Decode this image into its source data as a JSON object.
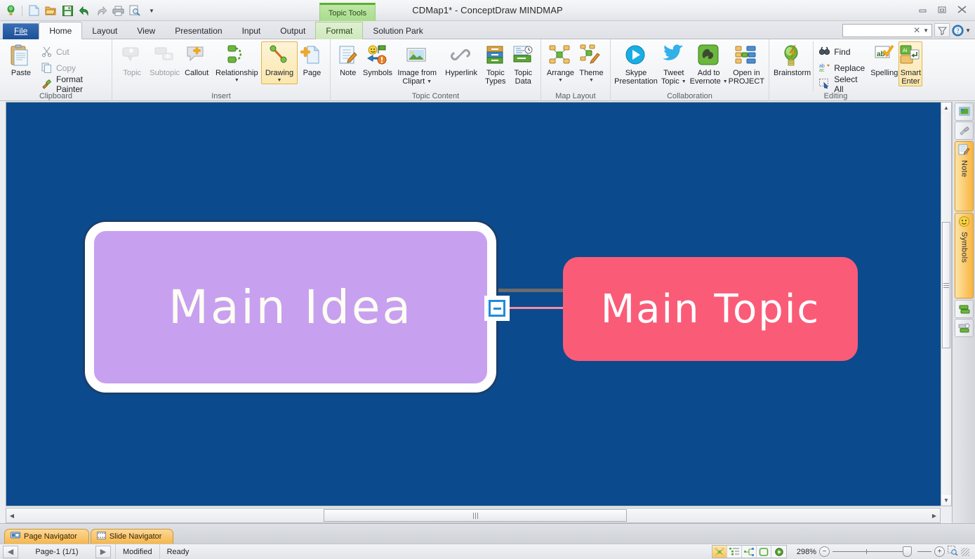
{
  "window": {
    "title": "CDMap1* - ConceptDraw MINDMAP",
    "contextual_tools_label": "Topic Tools",
    "minimize": "—",
    "restore": "❐",
    "close": "✕"
  },
  "quick_access": [
    {
      "name": "app-logo-icon",
      "label": "ConceptDraw"
    },
    {
      "name": "new-icon",
      "label": "New"
    },
    {
      "name": "open-icon",
      "label": "Open"
    },
    {
      "name": "save-icon",
      "label": "Save"
    },
    {
      "name": "undo-icon",
      "label": "Undo"
    },
    {
      "name": "redo-icon",
      "label": "Redo"
    },
    {
      "name": "print-icon",
      "label": "Print"
    },
    {
      "name": "print-preview-icon",
      "label": "Print Preview"
    },
    {
      "name": "qat-customize-icon",
      "label": "Customize Quick Access Toolbar"
    }
  ],
  "tabs": [
    {
      "label": "File",
      "state": "file"
    },
    {
      "label": "Home",
      "state": "active"
    },
    {
      "label": "Layout",
      "state": "normal"
    },
    {
      "label": "View",
      "state": "normal"
    },
    {
      "label": "Presentation",
      "state": "normal"
    },
    {
      "label": "Input",
      "state": "normal"
    },
    {
      "label": "Output",
      "state": "normal"
    },
    {
      "label": "Format",
      "state": "contextual"
    },
    {
      "label": "Solution Park",
      "state": "normal"
    }
  ],
  "search": {
    "value": "",
    "placeholder": "",
    "clear": "✕",
    "caret": "▼"
  },
  "ribbon": {
    "groups": [
      {
        "name": "clipboard",
        "label": "Clipboard",
        "big": [
          {
            "label": "Paste",
            "label2": "",
            "icon": "paste-icon",
            "state": "normal",
            "caret": false
          }
        ],
        "small": [
          {
            "label": "Cut",
            "icon": "cut-icon",
            "state": "disabled"
          },
          {
            "label": "Copy",
            "icon": "copy-icon",
            "state": "disabled"
          },
          {
            "label": "Format Painter",
            "icon": "format-painter-icon",
            "state": "normal"
          }
        ]
      },
      {
        "name": "insert",
        "label": "Insert",
        "big": [
          {
            "label": "Topic",
            "label2": "",
            "icon": "topic-icon",
            "state": "disabled",
            "caret": false
          },
          {
            "label": "Subtopic",
            "label2": "",
            "icon": "subtopic-icon",
            "state": "disabled",
            "caret": false
          },
          {
            "label": "Callout",
            "label2": "",
            "icon": "callout-icon",
            "state": "normal",
            "caret": false
          },
          {
            "label": "Relationship",
            "label2": "",
            "icon": "relationship-icon",
            "state": "normal",
            "caret": true
          },
          {
            "label": "Drawing",
            "label2": "",
            "icon": "drawing-icon",
            "state": "selected",
            "caret": true
          },
          {
            "label": "Page",
            "label2": "",
            "icon": "page-icon",
            "state": "normal",
            "caret": false
          }
        ],
        "small": []
      },
      {
        "name": "topic-content",
        "label": "Topic Content",
        "big": [
          {
            "label": "Note",
            "label2": "",
            "icon": "note-icon",
            "state": "normal",
            "caret": false
          },
          {
            "label": "Symbols",
            "label2": "",
            "icon": "symbols-icon",
            "state": "normal",
            "caret": false
          },
          {
            "label": "Image from",
            "label2": "Clipart",
            "icon": "image-clipart-icon",
            "state": "normal",
            "caret": true
          },
          {
            "label": "Hyperlink",
            "label2": "",
            "icon": "hyperlink-icon",
            "state": "normal",
            "caret": false
          },
          {
            "label": "Topic",
            "label2": "Types",
            "icon": "topic-types-icon",
            "state": "normal",
            "caret": false
          },
          {
            "label": "Topic",
            "label2": "Data",
            "icon": "topic-data-icon",
            "state": "normal",
            "caret": false
          }
        ],
        "small": []
      },
      {
        "name": "map-layout",
        "label": "Map Layout",
        "big": [
          {
            "label": "Arrange",
            "label2": "",
            "icon": "arrange-icon",
            "state": "normal",
            "caret": true
          },
          {
            "label": "Theme",
            "label2": "",
            "icon": "theme-icon",
            "state": "normal",
            "caret": true
          }
        ],
        "small": []
      },
      {
        "name": "collaboration",
        "label": "Collaboration",
        "big": [
          {
            "label": "Skype",
            "label2": "Presentation",
            "icon": "skype-icon",
            "state": "normal",
            "caret": false
          },
          {
            "label": "Tweet",
            "label2": "Topic",
            "icon": "twitter-icon",
            "state": "normal",
            "caret": true
          },
          {
            "label": "Add to",
            "label2": "Evernote",
            "icon": "evernote-icon",
            "state": "normal",
            "caret": true
          },
          {
            "label": "Open in",
            "label2": "PROJECT",
            "icon": "open-in-project-icon",
            "state": "normal",
            "caret": false
          }
        ],
        "small": []
      },
      {
        "name": "editing",
        "label": "Editing",
        "big": [
          {
            "label": "Brainstorm",
            "label2": "",
            "icon": "brainstorm-icon",
            "state": "normal",
            "caret": false
          }
        ],
        "small": [
          {
            "label": "Find",
            "icon": "find-icon",
            "state": "normal"
          },
          {
            "label": "Replace",
            "icon": "replace-icon",
            "state": "normal"
          },
          {
            "label": "Select All",
            "icon": "select-all-icon",
            "state": "normal"
          }
        ],
        "big2": [
          {
            "label": "Spelling",
            "label2": "",
            "icon": "spelling-icon",
            "state": "normal",
            "caret": false
          },
          {
            "label": "Smart",
            "label2": "Enter",
            "icon": "smart-enter-icon",
            "state": "selected",
            "caret": false
          }
        ]
      }
    ]
  },
  "canvas": {
    "background_color": "#0b4a8d",
    "nodes": [
      {
        "id": "main-idea",
        "text": "Main Idea",
        "fill": "#c8a0f0",
        "border": "#ffffff",
        "text_color": "#fdfdf3"
      },
      {
        "id": "main-topic",
        "text": "Main Topic",
        "fill": "#fa5c78",
        "border": "none",
        "text_color": "#ffffff"
      }
    ],
    "collapse_button": {
      "symbol": "−",
      "color": "#1e8be0"
    },
    "connector_colors": [
      "#6b6b6b",
      "#f58ba5"
    ]
  },
  "right_dock": [
    {
      "name": "dock-image-button",
      "label": "",
      "icon": "image-icon",
      "state": "plain"
    },
    {
      "name": "dock-brush-button",
      "label": "",
      "icon": "brush-icon",
      "state": "plain"
    },
    {
      "name": "dock-note-tab",
      "label": "Note",
      "icon": "note-pencil-icon",
      "state": "active"
    },
    {
      "name": "dock-symbols-tab",
      "label": "Symbols",
      "icon": "smiley-icon",
      "state": "active"
    },
    {
      "name": "dock-topic-button",
      "label": "",
      "icon": "topic-small-icon",
      "state": "plain"
    },
    {
      "name": "dock-topic-data-button",
      "label": "",
      "icon": "topic-data-small-icon",
      "state": "plain"
    }
  ],
  "nav_tabs": [
    {
      "label": "Page Navigator",
      "icon": "page-navigator-icon"
    },
    {
      "label": "Slide Navigator",
      "icon": "slide-navigator-icon"
    }
  ],
  "status": {
    "prev_arrow": "◀",
    "page_indicator": "Page-1 (1/1)",
    "next_arrow": "▶",
    "modified": "Modified",
    "ready": "Ready",
    "zoom_value": "298%",
    "zoom_out": "−",
    "zoom_in": "+",
    "view_buttons": [
      {
        "name": "view-mindmap-button",
        "state": "on"
      },
      {
        "name": "view-outline-button",
        "state": "off"
      },
      {
        "name": "view-tree-button",
        "state": "off"
      },
      {
        "name": "view-fit-button",
        "state": "off"
      },
      {
        "name": "view-presentation-button",
        "state": "off"
      }
    ],
    "fit-page-icon": "fit-page-icon"
  },
  "scrollbars": {
    "v_up": "▲",
    "v_down": "▼",
    "h_left": "◀",
    "h_right": "▶"
  }
}
